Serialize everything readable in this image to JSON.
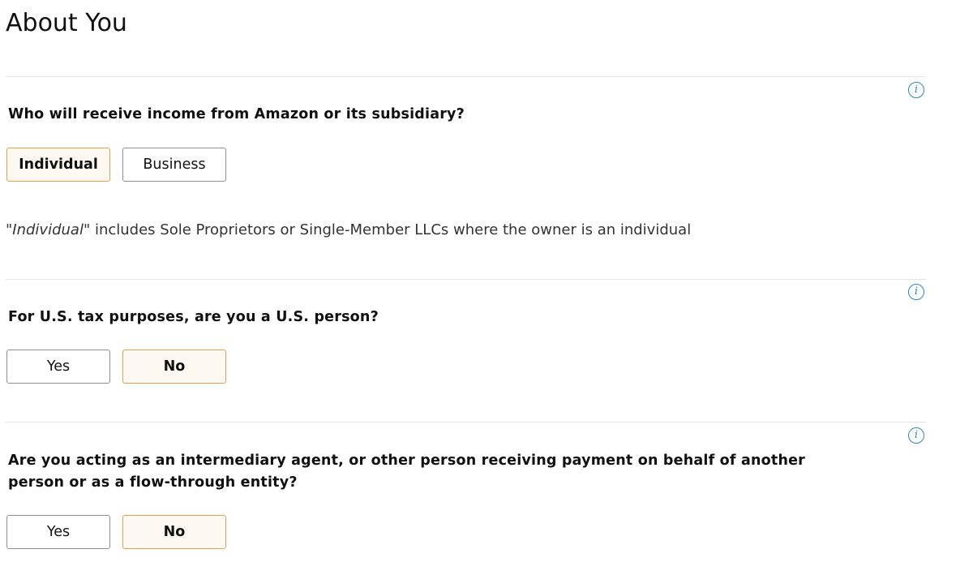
{
  "page": {
    "title": "About You"
  },
  "sections": [
    {
      "question": "Who will receive income from Amazon or its subsidiary?",
      "options": [
        {
          "label": "Individual",
          "selected": true
        },
        {
          "label": "Business",
          "selected": false
        }
      ],
      "note": {
        "emphasis": "\"Individual\"",
        "text": " includes Sole Proprietors or Single-Member LLCs where the owner is an individual"
      },
      "info_icon": "i"
    },
    {
      "question": "For U.S. tax purposes, are you a U.S. person?",
      "options": [
        {
          "label": "Yes",
          "selected": false
        },
        {
          "label": "No",
          "selected": true
        }
      ],
      "info_icon": "i"
    },
    {
      "question": "Are you acting as an intermediary agent, or other person receiving payment on behalf of another person or as a flow-through entity?",
      "options": [
        {
          "label": "Yes",
          "selected": false
        },
        {
          "label": "No",
          "selected": true
        }
      ],
      "info_icon": "i"
    }
  ],
  "colors": {
    "selected_border": "#e3a24a",
    "selected_background": "#fef8f2",
    "info_icon": "#2a8bb6",
    "divider": "#e3e6e6"
  }
}
